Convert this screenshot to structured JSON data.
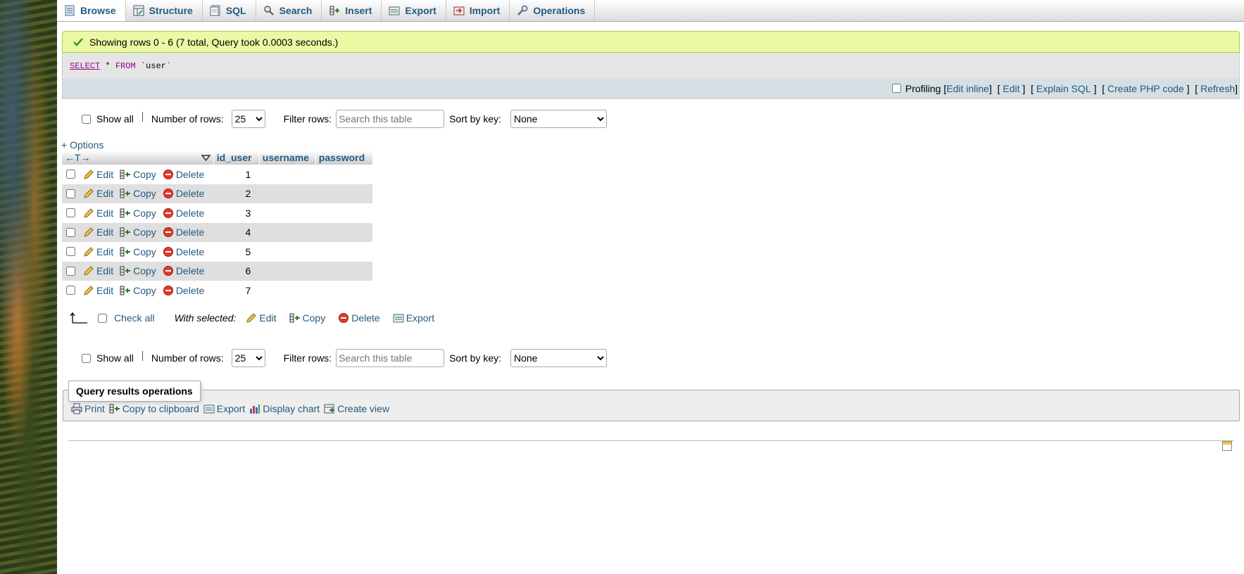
{
  "tabs": [
    {
      "label": "Browse",
      "icon": "browse-icon",
      "active": true
    },
    {
      "label": "Structure",
      "icon": "structure-icon"
    },
    {
      "label": "SQL",
      "icon": "sql-icon"
    },
    {
      "label": "Search",
      "icon": "search-icon"
    },
    {
      "label": "Insert",
      "icon": "insert-icon"
    },
    {
      "label": "Export",
      "icon": "export-icon"
    },
    {
      "label": "Import",
      "icon": "import-icon"
    },
    {
      "label": "Operations",
      "icon": "wrench-icon"
    }
  ],
  "success_message": "Showing rows 0 - 6 (7 total, Query took 0.0003 seconds.)",
  "sql": {
    "select": "SELECT",
    "star": "*",
    "from": "FROM",
    "table": "`user`"
  },
  "sql_tools": {
    "profiling": "Profiling",
    "edit_inline": "Edit inline",
    "edit": "Edit",
    "explain": "Explain SQL",
    "create_php": "Create PHP code",
    "refresh": "Refresh"
  },
  "nav": {
    "show_all": "Show all",
    "number_of_rows_label": "Number of rows:",
    "number_of_rows_value": "25",
    "filter_label": "Filter rows:",
    "filter_placeholder": "Search this table",
    "sort_label": "Sort by key:",
    "sort_value": "None"
  },
  "options_label": "+ Options",
  "table": {
    "arrows": "←T→",
    "columns": [
      "id_user",
      "username",
      "password"
    ],
    "row_actions": {
      "edit": "Edit",
      "copy": "Copy",
      "delete": "Delete"
    },
    "rows": [
      {
        "id_user": "1",
        "username": "",
        "password": ""
      },
      {
        "id_user": "2",
        "username": "",
        "password": ""
      },
      {
        "id_user": "3",
        "username": "",
        "password": ""
      },
      {
        "id_user": "4",
        "username": "",
        "password": ""
      },
      {
        "id_user": "5",
        "username": "",
        "password": ""
      },
      {
        "id_user": "6",
        "username": "",
        "password": ""
      },
      {
        "id_user": "7",
        "username": "",
        "password": ""
      }
    ]
  },
  "with_selected": {
    "check_all": "Check all",
    "label": "With selected:",
    "edit": "Edit",
    "copy": "Copy",
    "delete": "Delete",
    "export": "Export"
  },
  "query_ops": {
    "legend": "Query results operations",
    "print": "Print",
    "copy_clipboard": "Copy to clipboard",
    "export": "Export",
    "display_chart": "Display chart",
    "create_view": "Create view"
  },
  "colors": {
    "success_bg": "#ebf8a4",
    "link": "#235a81",
    "even_row": "#dfdfdf"
  }
}
